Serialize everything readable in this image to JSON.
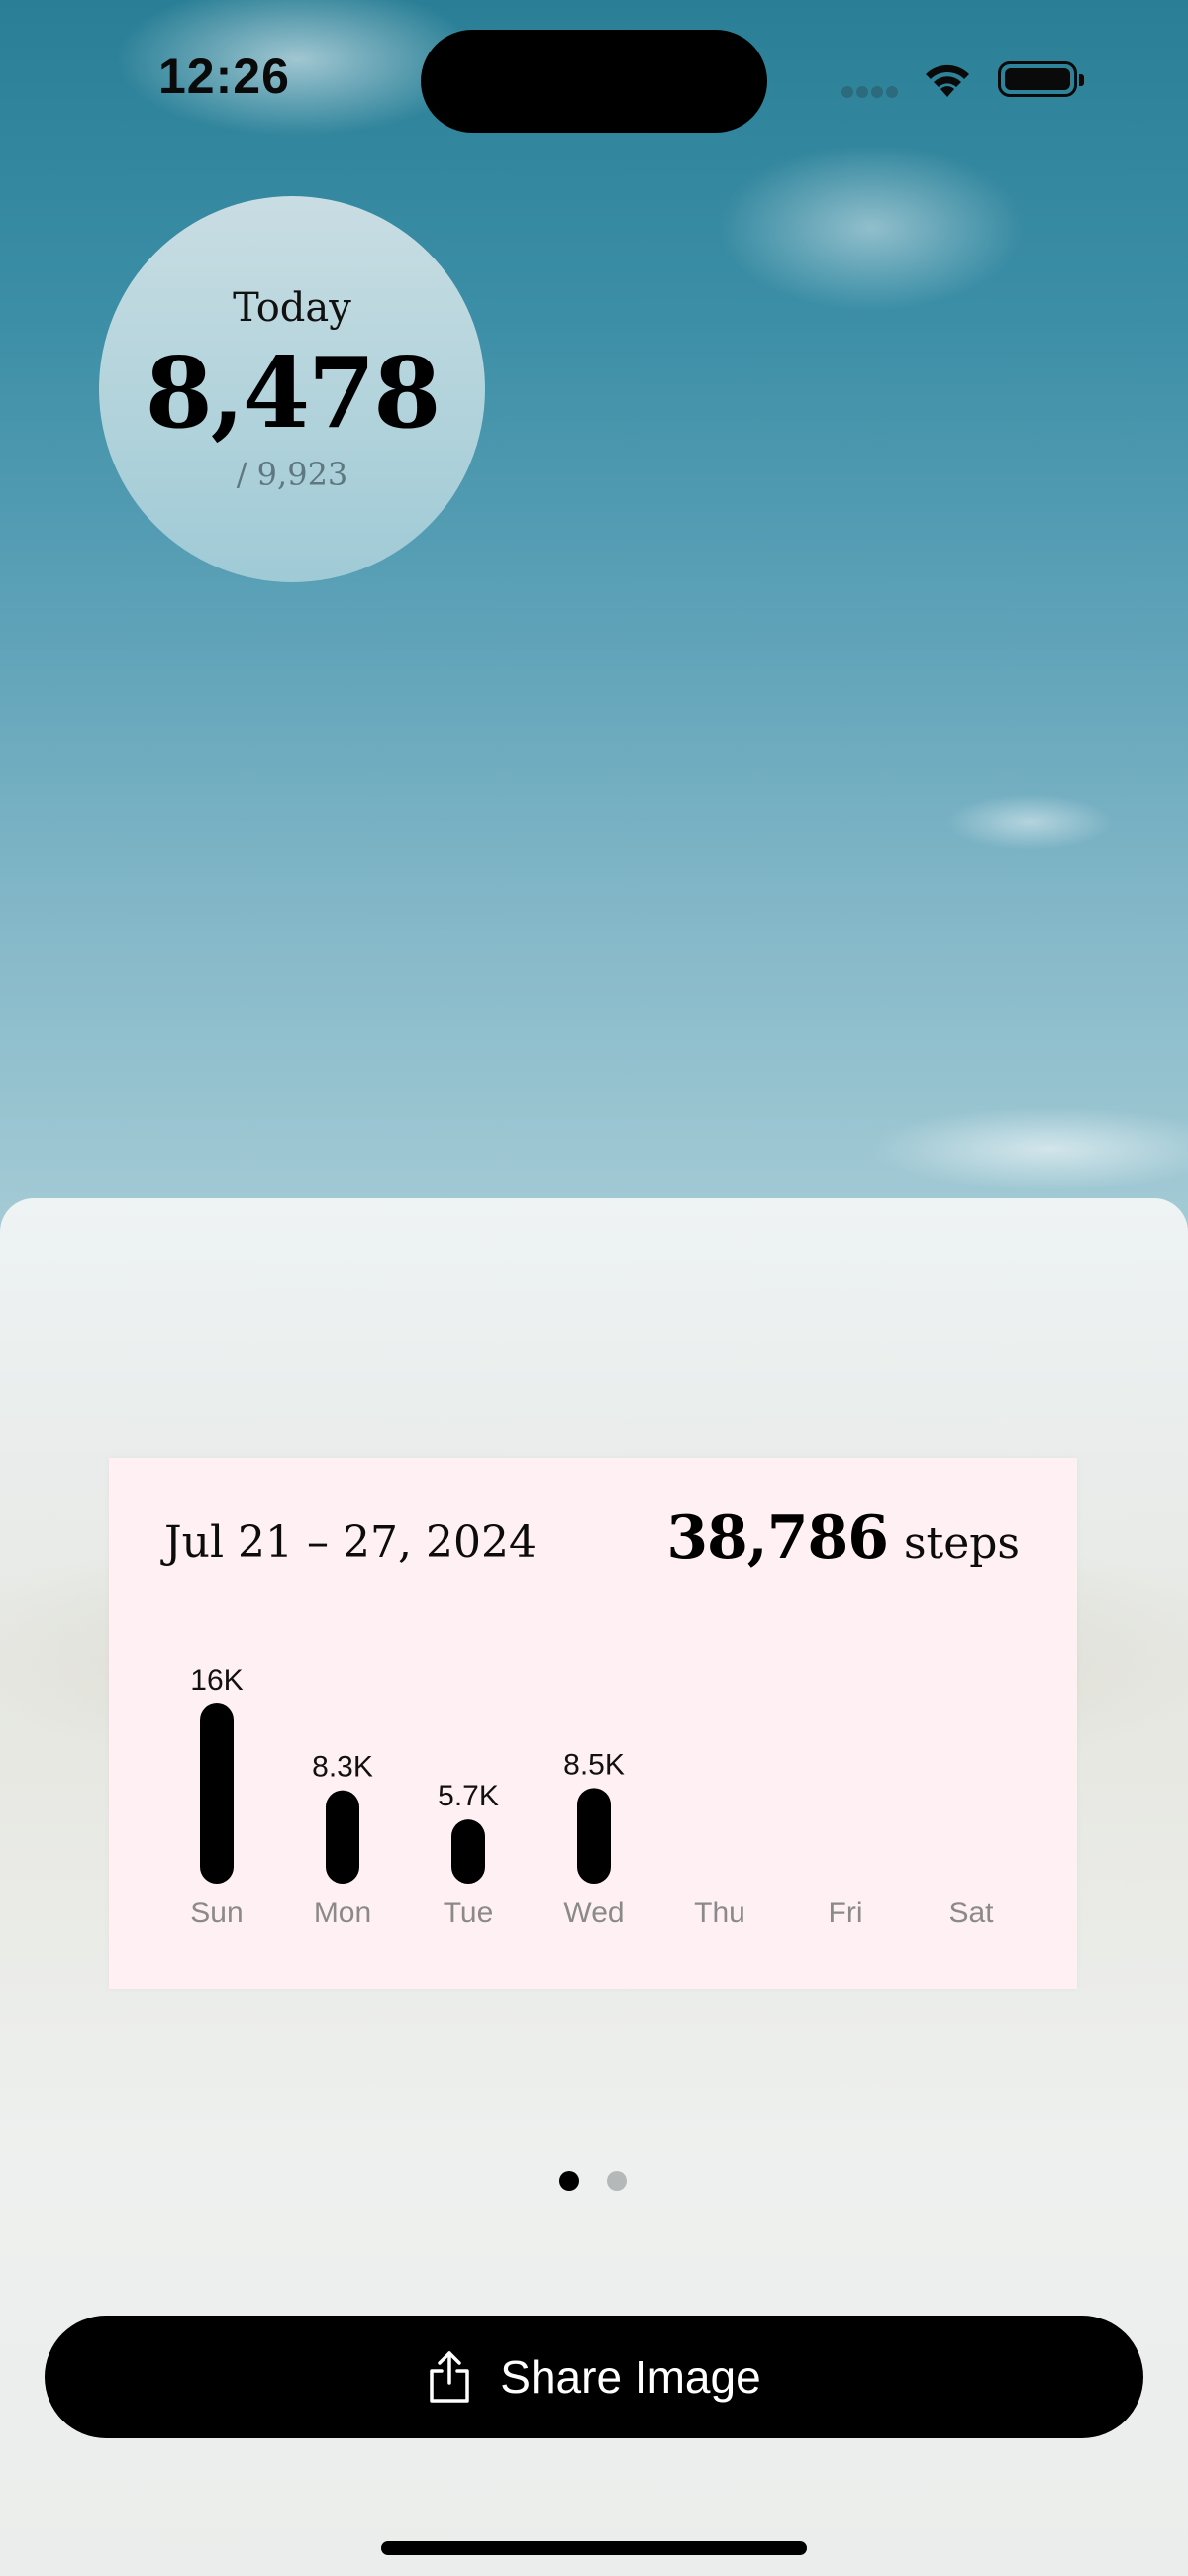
{
  "status_bar": {
    "time": "12:26"
  },
  "today": {
    "label": "Today",
    "value": "8,478",
    "goal": "/ 9,923"
  },
  "card": {
    "date_range": "Jul 21 – 27, 2024",
    "total": "38,786",
    "unit": "steps"
  },
  "chart_data": {
    "type": "bar",
    "categories": [
      "Sun",
      "Mon",
      "Tue",
      "Wed",
      "Thu",
      "Fri",
      "Sat"
    ],
    "values": [
      16000,
      8300,
      5700,
      8500,
      null,
      null,
      null
    ],
    "labels": [
      "16K",
      "8.3K",
      "5.7K",
      "8.5K",
      "",
      "",
      ""
    ],
    "ylim": [
      0,
      16000
    ]
  },
  "pager": {
    "count": 2,
    "active": 0
  },
  "share_button": {
    "label": "Share Image"
  },
  "colors": {
    "bar": "#000000",
    "card_bg": "#fff0f4",
    "day_label": "#8a8a8a"
  }
}
